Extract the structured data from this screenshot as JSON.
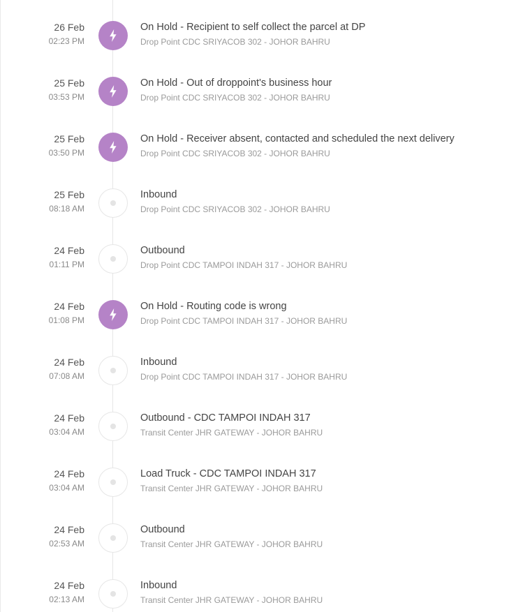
{
  "events": [
    {
      "date": "26 Feb",
      "time": "02:23 PM",
      "type": "hold",
      "icon": "bolt-icon",
      "title": "On Hold - Recipient to self collect the parcel at DP",
      "location": "Drop Point CDC SRIYACOB 302 - JOHOR BAHRU"
    },
    {
      "date": "25 Feb",
      "time": "03:53 PM",
      "type": "hold",
      "icon": "bolt-icon",
      "title": "On Hold - Out of droppoint's business hour",
      "location": "Drop Point CDC SRIYACOB 302 - JOHOR BAHRU"
    },
    {
      "date": "25 Feb",
      "time": "03:50 PM",
      "type": "hold",
      "icon": "bolt-icon",
      "title": "On Hold - Receiver absent, contacted and scheduled the next delivery",
      "location": "Drop Point CDC SRIYACOB 302 - JOHOR BAHRU"
    },
    {
      "date": "25 Feb",
      "time": "08:18 AM",
      "type": "normal",
      "icon": "dot-icon",
      "title": "Inbound",
      "location": "Drop Point CDC SRIYACOB 302 - JOHOR BAHRU"
    },
    {
      "date": "24 Feb",
      "time": "01:11 PM",
      "type": "normal",
      "icon": "dot-icon",
      "title": "Outbound",
      "location": "Drop Point CDC TAMPOI INDAH 317 - JOHOR BAHRU"
    },
    {
      "date": "24 Feb",
      "time": "01:08 PM",
      "type": "hold",
      "icon": "bolt-icon",
      "title": "On Hold - Routing code is wrong",
      "location": "Drop Point CDC TAMPOI INDAH 317 - JOHOR BAHRU"
    },
    {
      "date": "24 Feb",
      "time": "07:08 AM",
      "type": "normal",
      "icon": "dot-icon",
      "title": "Inbound",
      "location": "Drop Point CDC TAMPOI INDAH 317 - JOHOR BAHRU"
    },
    {
      "date": "24 Feb",
      "time": "03:04 AM",
      "type": "normal",
      "icon": "dot-icon",
      "title": "Outbound - CDC TAMPOI INDAH 317",
      "location": "Transit Center JHR GATEWAY - JOHOR BAHRU"
    },
    {
      "date": "24 Feb",
      "time": "03:04 AM",
      "type": "normal",
      "icon": "dot-icon",
      "title": "Load Truck - CDC TAMPOI INDAH 317",
      "location": "Transit Center JHR GATEWAY - JOHOR BAHRU"
    },
    {
      "date": "24 Feb",
      "time": "02:53 AM",
      "type": "normal",
      "icon": "dot-icon",
      "title": "Outbound",
      "location": "Transit Center JHR GATEWAY - JOHOR BAHRU"
    },
    {
      "date": "24 Feb",
      "time": "02:13 AM",
      "type": "normal",
      "icon": "dot-icon",
      "title": "Inbound",
      "location": "Transit Center JHR GATEWAY - JOHOR BAHRU"
    }
  ],
  "colors": {
    "hold_marker": "#b583c7",
    "line": "#e6e6e6"
  }
}
